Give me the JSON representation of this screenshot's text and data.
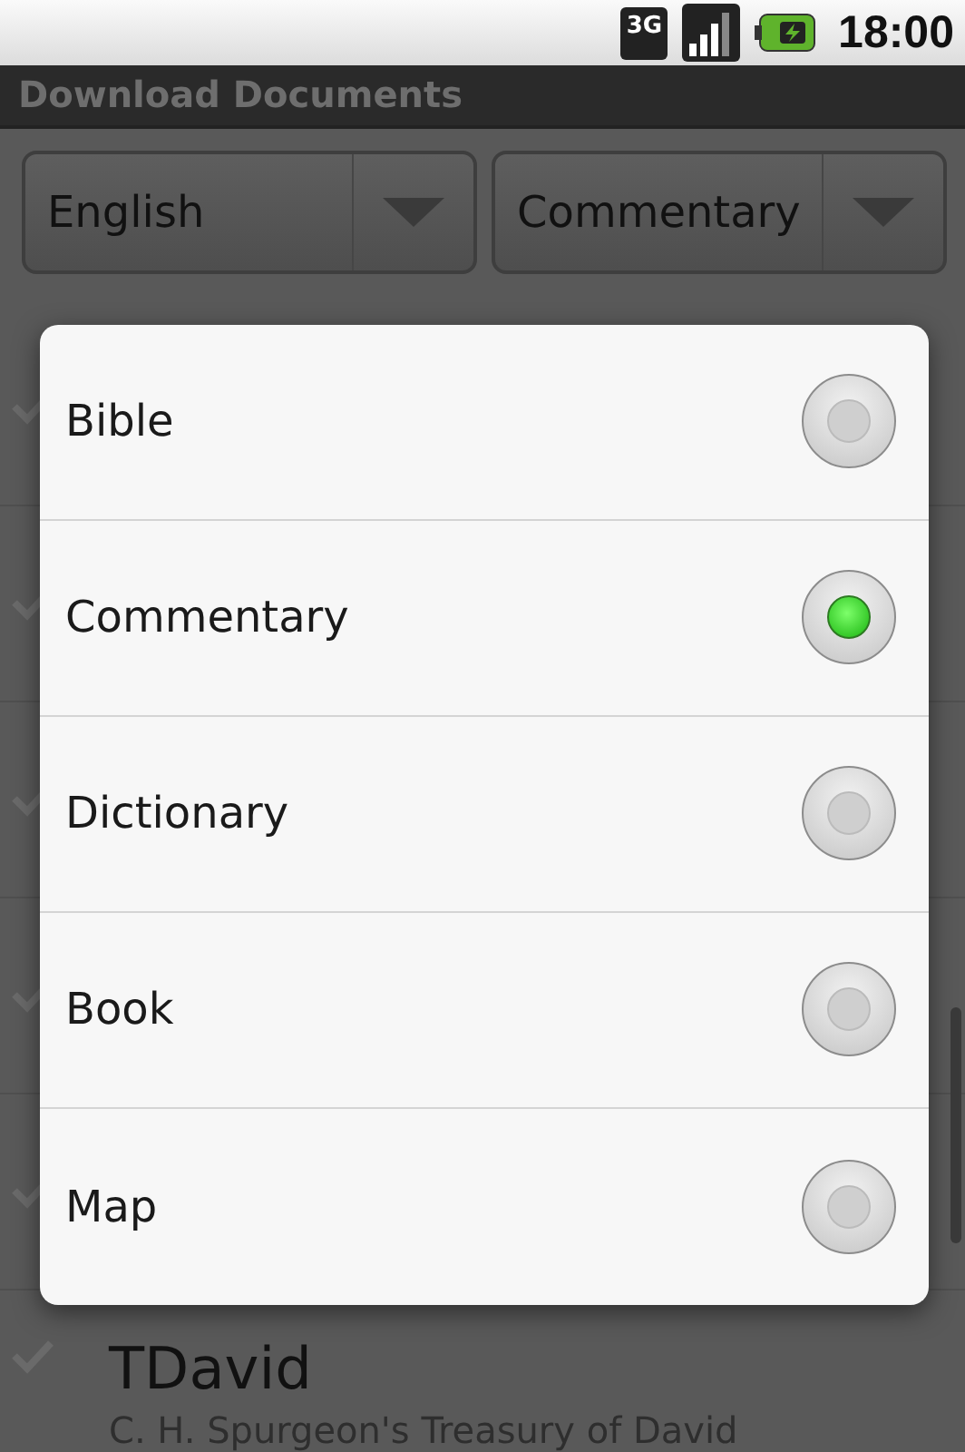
{
  "status_bar": {
    "network": "3G",
    "time": "18:00"
  },
  "title": "Download Documents",
  "spinners": [
    {
      "value": "English"
    },
    {
      "value": "Commentary"
    }
  ],
  "list": {
    "items": [
      {
        "title": "TDavid",
        "subtitle": "C. H. Spurgeon's Treasury of David"
      }
    ]
  },
  "dialog": {
    "options": [
      {
        "label": "Bible",
        "selected": false
      },
      {
        "label": "Commentary",
        "selected": true
      },
      {
        "label": "Dictionary",
        "selected": false
      },
      {
        "label": "Book",
        "selected": false
      },
      {
        "label": "Map",
        "selected": false
      }
    ]
  }
}
